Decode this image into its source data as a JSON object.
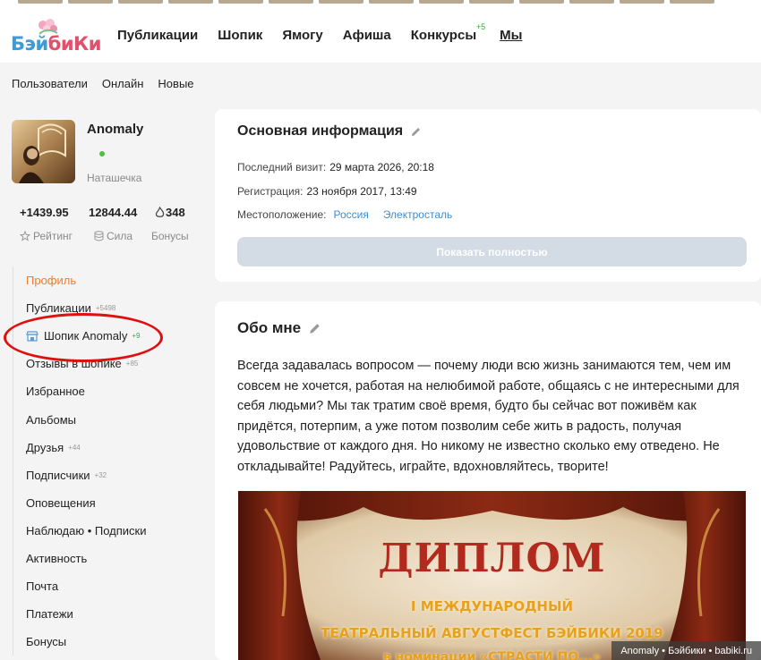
{
  "logo": {
    "part1": "Бэй",
    "part2": "биКи"
  },
  "nav": [
    {
      "label": "Публикации"
    },
    {
      "label": "Шопик"
    },
    {
      "label": "Ямогу"
    },
    {
      "label": "Афиша"
    },
    {
      "label": "Конкурсы",
      "badge": "+5"
    },
    {
      "label": "Мы"
    }
  ],
  "subnav": [
    "Пользователи",
    "Онлайн",
    "Новые"
  ],
  "profile": {
    "name": "Anomaly",
    "nickname": "Наташечка",
    "stats": {
      "rating": "+1439.95",
      "power": "12844.44",
      "bonuses": "348"
    },
    "stat_labels": {
      "rating": "Рейтинг",
      "power": "Сила",
      "bonuses": "Бонусы"
    }
  },
  "menu": [
    {
      "label": "Профиль"
    },
    {
      "label": "Публикации",
      "count": "5498"
    },
    {
      "label": "Шопик Anomaly",
      "count": "9"
    },
    {
      "label": "Отзывы в шопике",
      "count": "85"
    },
    {
      "label": "Избранное"
    },
    {
      "label": "Альбомы"
    },
    {
      "label": "Друзья",
      "count": "44"
    },
    {
      "label": "Подписчики",
      "count": "32"
    },
    {
      "label": "Оповещения"
    },
    {
      "label": "Наблюдаю • Подписки"
    },
    {
      "label": "Активность"
    },
    {
      "label": "Почта"
    },
    {
      "label": "Платежи"
    },
    {
      "label": "Бонусы"
    }
  ],
  "basic_info": {
    "title": "Основная информация",
    "last_visit_label": "Последний визит:",
    "last_visit": "29 марта 2026, 20:18",
    "registration_label": "Регистрация:",
    "registration": "23 ноября 2017, 13:49",
    "location_label": "Местоположение:",
    "country": "Россия",
    "city": "Электросталь",
    "show_full": "Показать полностью"
  },
  "about": {
    "title": "Обо мне",
    "text": "Всегда задавалась вопросом — почему люди всю жизнь занимаются тем, чем им совсем не хочется, работая на нелюбимой работе, общаясь с не интересными для себя людьми? Мы так тратим своё время, будто бы сейчас вот поживём как придётся, потерпим, а уже потом позволим себе жить в радость, получая удовольствие от каждого дня. Но никому не известно сколько ему отведено. Не откладывайте! Радуйтесь, играйте, вдохновляйтесь, творите!",
    "diploma": {
      "title": "ДИПЛОМ",
      "line1": "I МЕЖДУНАРОДНЫЙ",
      "line2": "ТЕАТРАЛЬНЫЙ АВГУСТФЕСТ БЭЙБИКИ 2019",
      "line3": "в номинации «СТРАСТИ ПО...»"
    }
  },
  "watermark": "Anomaly • Бэйбики • babiki.ru"
}
